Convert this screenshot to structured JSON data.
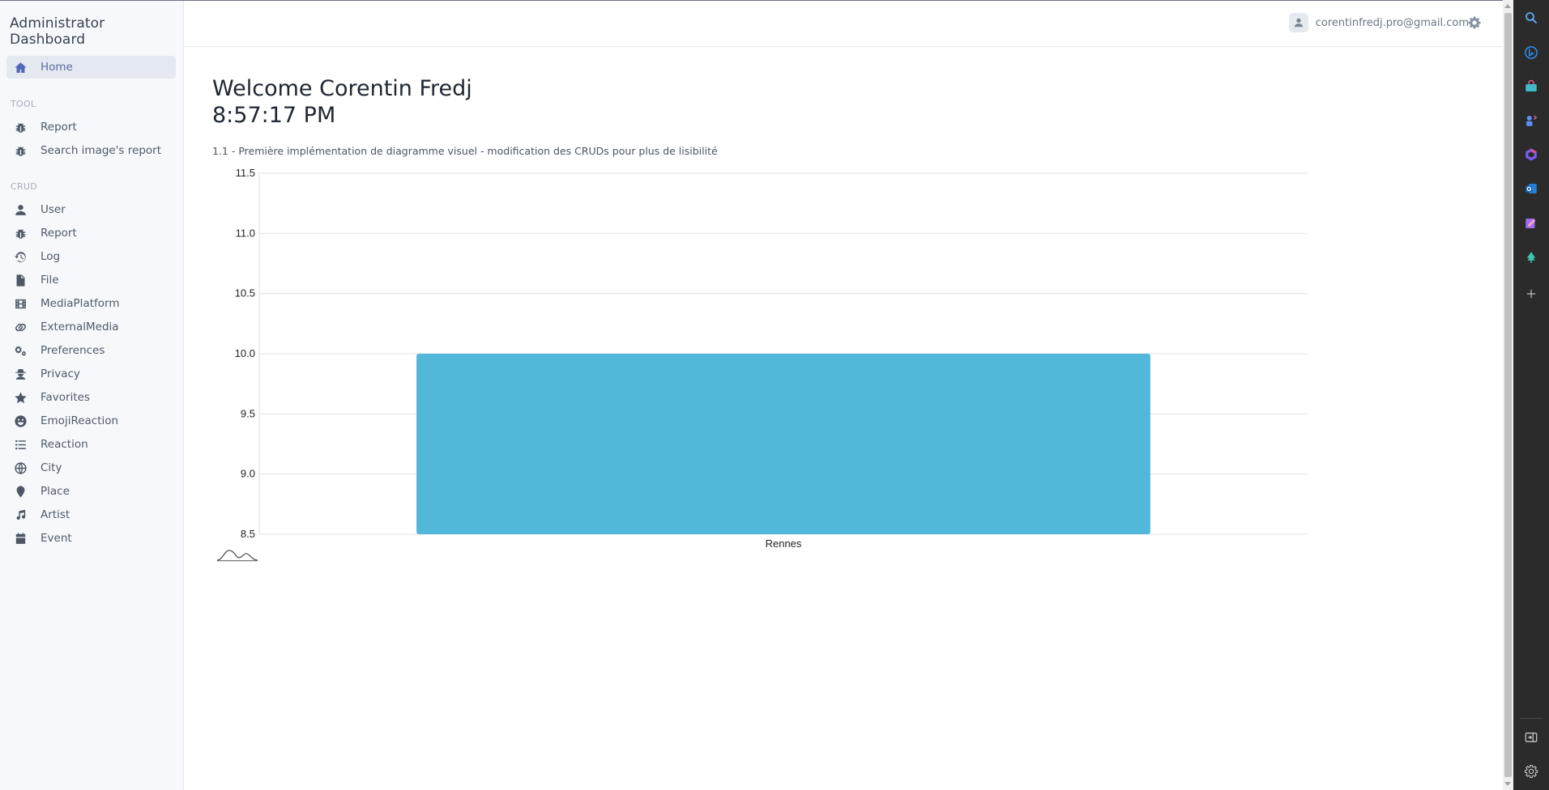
{
  "app": {
    "title": "Administrator Dashboard"
  },
  "sidebar": {
    "home": {
      "label": "Home",
      "icon": "home-icon"
    },
    "sections": [
      {
        "label": "TOOL",
        "items": [
          {
            "label": "Report",
            "icon": "bug-icon"
          },
          {
            "label": "Search image's report",
            "icon": "bug-icon"
          }
        ]
      },
      {
        "label": "CRUD",
        "items": [
          {
            "label": "User",
            "icon": "user-icon"
          },
          {
            "label": "Report",
            "icon": "bug-icon"
          },
          {
            "label": "Log",
            "icon": "history-icon"
          },
          {
            "label": "File",
            "icon": "file-icon"
          },
          {
            "label": "MediaPlatform",
            "icon": "film-icon"
          },
          {
            "label": "ExternalMedia",
            "icon": "link-icon"
          },
          {
            "label": "Preferences",
            "icon": "gears-icon"
          },
          {
            "label": "Privacy",
            "icon": "user-secret-icon"
          },
          {
            "label": "Favorites",
            "icon": "star-icon"
          },
          {
            "label": "EmojiReaction",
            "icon": "smile-icon"
          },
          {
            "label": "Reaction",
            "icon": "list-icon"
          },
          {
            "label": "City",
            "icon": "globe-icon"
          },
          {
            "label": "Place",
            "icon": "map-pin-icon"
          },
          {
            "label": "Artist",
            "icon": "music-icon"
          },
          {
            "label": "Event",
            "icon": "calendar-icon"
          }
        ]
      }
    ]
  },
  "header": {
    "user_email": "corentinfredj.pro@gmail.com",
    "avatar_icon": "user-icon",
    "settings_icon": "gear-icon"
  },
  "main": {
    "welcome": "Welcome Corentin Fredj",
    "clock": "8:57:17 PM",
    "version_note": "1.1 - Première implémentation de diagramme visuel - modification des CRUDs pour plus de lisibilité",
    "chart_type_icon": "bell-curve-icon"
  },
  "chart_data": {
    "type": "bar",
    "categories": [
      "Rennes"
    ],
    "values": [
      10
    ],
    "title": "",
    "xlabel": "",
    "ylabel": "",
    "ylim": [
      8.5,
      11.5
    ],
    "yticks": [
      "11.5",
      "11.0",
      "10.5",
      "10.0",
      "9.5",
      "9.0",
      "8.5"
    ],
    "bar_color": "#52b8d9",
    "grid": true,
    "legend": "none"
  },
  "colors": {
    "accent": "#5168b8",
    "sidebar_bg": "#f6f8fb",
    "edge_panel_bg": "#2b2b2b"
  },
  "edge_panel": {
    "buttons": [
      "search-icon",
      "copilot-icon",
      "shopping-icon",
      "games-icon",
      "office-icon",
      "outlook-icon",
      "drop-icon",
      "tree-icon",
      "add-icon"
    ],
    "bottom": [
      "sidebar-toggle-icon",
      "settings-icon"
    ]
  }
}
